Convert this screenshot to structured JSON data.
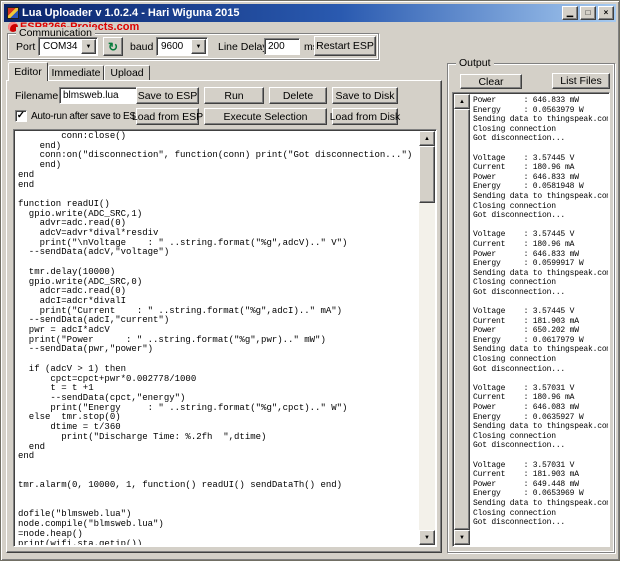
{
  "titlebar": {
    "title": "Lua Uploader v 1.0.2.4 - Hari Wiguna 2015"
  },
  "link": {
    "label": "ESP8266-Projects.com"
  },
  "communication": {
    "group_label": "Communication",
    "port_label": "Port",
    "port_value": "COM34",
    "baud_label": "baud",
    "baud_value": "9600",
    "line_delay_label": "Line Delay",
    "line_delay_value": "200",
    "ms_label": "ms",
    "restart_button_label": "Restart ESP"
  },
  "tabs": {
    "editor": "Editor",
    "immediate": "Immediate",
    "upload": "Upload"
  },
  "editor": {
    "filename_label": "Filename:",
    "filename_value": "blmsweb.lua",
    "save_to_esp": "Save to ESP",
    "run": "Run",
    "delete": "Delete",
    "save_to_disk": "Save to Disk",
    "autorun_label": "Auto-run after save to ESP",
    "autorun_checked": true,
    "load_from_esp": "Load from ESP",
    "execute_selection": "Execute Selection",
    "load_from_disk": "Load from Disk",
    "code": "        conn:close()\n    end)\n    conn:on(\"disconnection\", function(conn) print(\"Got disconnection...\")\n    end)\nend\nend\n\nfunction readUI()\n  gpio.write(ADC_SRC,1)\n    advr=adc.read(0)\n    adcV=advr*dival*resdiv\n    print(\"\\nVoltage    : \" ..string.format(\"%g\",adcV)..\" V\")\n  --sendData(adcV,\"voltage\")\n\n  tmr.delay(10000)\n  gpio.write(ADC_SRC,0)\n    adcr=adc.read(0)\n    adcI=adcr*divalI\n    print(\"Current    : \" ..string.format(\"%g\",adcI)..\" mA\")\n  --sendData(adcI,\"current\")\n  pwr = adcI*adcV\n  print(\"Power      : \" ..string.format(\"%g\",pwr)..\" mW\")\n  --sendData(pwr,\"power\")\n\n  if (adcV > 1) then\n      cpct=cpct+pwr*0.002778/1000\n      t = t +1\n      --sendData(cpct,\"energy\")\n      print(\"Energy     : \" ..string.format(\"%g\",cpct)..\" W\")\n  else  tmr.stop(0)\n      dtime = t/360\n        print(\"Discharge Time: %.2fh  \",dtime)\n  end\nend\n\n\ntmr.alarm(0, 10000, 1, function() readUI() sendDataTh() end)\n\n\ndofile(\"blmsweb.lua\")\nnode.compile(\"blmsweb.lua\")\n=node.heap()\nprint(wifi.sta.getip())"
  },
  "output": {
    "group_label": "Output",
    "clear": "Clear",
    "list_files": "List Files",
    "text": "Power      : 646.833 mW\nEnergy     : 0.0563979 W\nSending data to thingspeak.com\nClosing connection\nGot disconnection...\n\nVoltage    : 3.57445 V\nCurrent    : 180.96 mA\nPower      : 646.833 mW\nEnergy     : 0.0581948 W\nSending data to thingspeak.com\nClosing connection\nGot disconnection...\n\nVoltage    : 3.57445 V\nCurrent    : 180.96 mA\nPower      : 646.833 mW\nEnergy     : 0.0599917 W\nSending data to thingspeak.com\nClosing connection\nGot disconnection...\n\nVoltage    : 3.57445 V\nCurrent    : 181.903 mA\nPower      : 650.202 mW\nEnergy     : 0.0617979 W\nSending data to thingspeak.com\nClosing connection\nGot disconnection...\n\nVoltage    : 3.57031 V\nCurrent    : 180.96 mA\nPower      : 646.083 mW\nEnergy     : 0.0635927 W\nSending data to thingspeak.com\nClosing connection\nGot disconnection...\n\nVoltage    : 3.57031 V\nCurrent    : 181.903 mA\nPower      : 649.448 mW\nEnergy     : 0.0653969 W\nSending data to thingspeak.com\nClosing connection\nGot disconnection..."
  },
  "icons": {
    "minimize": "▁",
    "maximize": "□",
    "close": "×",
    "combo_arrow": "▼",
    "scroll_up": "▲",
    "scroll_down": "▼",
    "refresh": "↻",
    "check": "✓"
  },
  "colors": {
    "window_bg": "#d4d0c8",
    "titlebar_left": "#0a246a",
    "titlebar_right": "#a6caf0",
    "link_red": "#dd0000"
  }
}
